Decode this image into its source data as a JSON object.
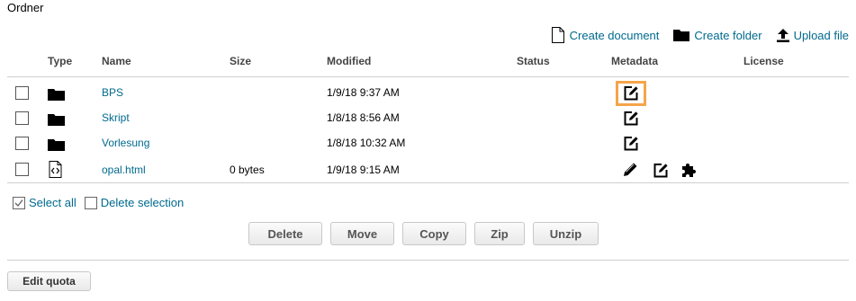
{
  "title": "Ordner",
  "toolbar": {
    "create_document": "Create document",
    "create_folder": "Create folder",
    "upload_file": "Upload file"
  },
  "columns": {
    "type": "Type",
    "name": "Name",
    "size": "Size",
    "modified": "Modified",
    "status": "Status",
    "metadata": "Metadata",
    "license": "License"
  },
  "rows": [
    {
      "type_icon": "folder-icon",
      "name": "BPS",
      "size": "",
      "modified": "1/9/18 9:37 AM"
    },
    {
      "type_icon": "folder-icon",
      "name": "Skript",
      "size": "",
      "modified": "1/8/18 8:56 AM"
    },
    {
      "type_icon": "folder-icon",
      "name": "Vorlesung",
      "size": "",
      "modified": "1/8/18 10:32 AM"
    },
    {
      "type_icon": "code-file-icon",
      "name": "opal.html",
      "size": "0 bytes",
      "modified": "1/9/18 9:15 AM"
    }
  ],
  "selection": {
    "select_all": "Select all",
    "delete_selection": "Delete selection"
  },
  "actions": {
    "delete": "Delete",
    "move": "Move",
    "copy": "Copy",
    "zip": "Zip",
    "unzip": "Unzip"
  },
  "edit_quota": "Edit quota",
  "colors": {
    "link": "#006a8e",
    "highlight": "#f5a54a"
  }
}
